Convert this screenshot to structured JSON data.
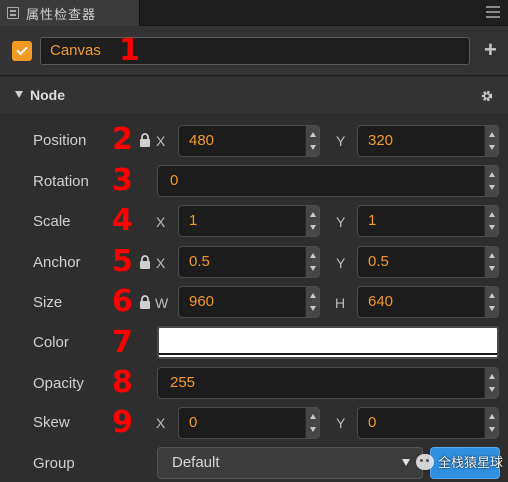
{
  "tab": {
    "title": "属性检查器",
    "icon": "inspector-icon"
  },
  "header": {
    "node_name": "Canvas",
    "enabled": true,
    "add_label": "+"
  },
  "section": {
    "title": "Node",
    "collapsed": false
  },
  "properties": {
    "position": {
      "label": "Position",
      "marker": "2",
      "locked": true,
      "x_label": "X",
      "x": "480",
      "y_label": "Y",
      "y": "320"
    },
    "rotation": {
      "label": "Rotation",
      "marker": "3",
      "value": "0"
    },
    "scale": {
      "label": "Scale",
      "marker": "4",
      "x_label": "X",
      "x": "1",
      "y_label": "Y",
      "y": "1"
    },
    "anchor": {
      "label": "Anchor",
      "marker": "5",
      "locked": true,
      "x_label": "X",
      "x": "0.5",
      "y_label": "Y",
      "y": "0.5"
    },
    "size": {
      "label": "Size",
      "marker": "6",
      "locked": true,
      "w_label": "W",
      "w": "960",
      "h_label": "H",
      "h": "640"
    },
    "color": {
      "label": "Color",
      "marker": "7",
      "value": "#ffffff"
    },
    "opacity": {
      "label": "Opacity",
      "marker": "8",
      "value": "255"
    },
    "skew": {
      "label": "Skew",
      "marker": "9",
      "x_label": "X",
      "x": "0",
      "y_label": "Y",
      "y": "0"
    },
    "group": {
      "label": "Group",
      "value": "Default"
    }
  },
  "name_marker": "1",
  "watermark": "全栈猿星球",
  "colors": {
    "accent": "#f29a24",
    "marker": "#ff0000",
    "button": "#2f8fe0",
    "background": "#2e2e2e"
  }
}
